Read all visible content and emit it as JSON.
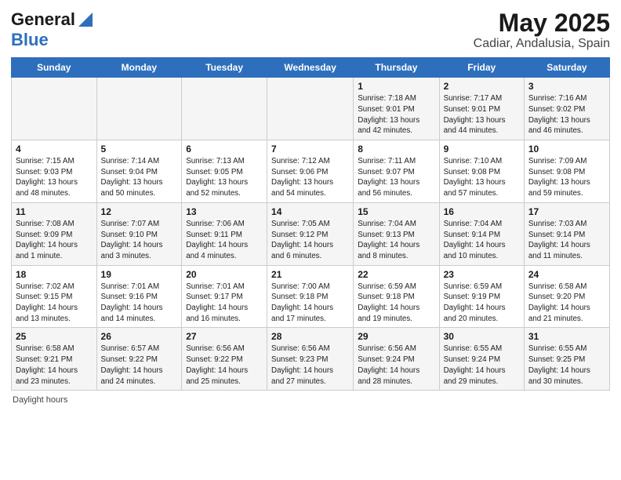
{
  "header": {
    "logo_line1": "General",
    "logo_line2": "Blue",
    "title": "May 2025",
    "subtitle": "Cadiar, Andalusia, Spain"
  },
  "days_of_week": [
    "Sunday",
    "Monday",
    "Tuesday",
    "Wednesday",
    "Thursday",
    "Friday",
    "Saturday"
  ],
  "footer_text": "Daylight hours",
  "weeks": [
    [
      {
        "day": "",
        "info": ""
      },
      {
        "day": "",
        "info": ""
      },
      {
        "day": "",
        "info": ""
      },
      {
        "day": "",
        "info": ""
      },
      {
        "day": "1",
        "info": "Sunrise: 7:18 AM\nSunset: 9:01 PM\nDaylight: 13 hours\nand 42 minutes."
      },
      {
        "day": "2",
        "info": "Sunrise: 7:17 AM\nSunset: 9:01 PM\nDaylight: 13 hours\nand 44 minutes."
      },
      {
        "day": "3",
        "info": "Sunrise: 7:16 AM\nSunset: 9:02 PM\nDaylight: 13 hours\nand 46 minutes."
      }
    ],
    [
      {
        "day": "4",
        "info": "Sunrise: 7:15 AM\nSunset: 9:03 PM\nDaylight: 13 hours\nand 48 minutes."
      },
      {
        "day": "5",
        "info": "Sunrise: 7:14 AM\nSunset: 9:04 PM\nDaylight: 13 hours\nand 50 minutes."
      },
      {
        "day": "6",
        "info": "Sunrise: 7:13 AM\nSunset: 9:05 PM\nDaylight: 13 hours\nand 52 minutes."
      },
      {
        "day": "7",
        "info": "Sunrise: 7:12 AM\nSunset: 9:06 PM\nDaylight: 13 hours\nand 54 minutes."
      },
      {
        "day": "8",
        "info": "Sunrise: 7:11 AM\nSunset: 9:07 PM\nDaylight: 13 hours\nand 56 minutes."
      },
      {
        "day": "9",
        "info": "Sunrise: 7:10 AM\nSunset: 9:08 PM\nDaylight: 13 hours\nand 57 minutes."
      },
      {
        "day": "10",
        "info": "Sunrise: 7:09 AM\nSunset: 9:08 PM\nDaylight: 13 hours\nand 59 minutes."
      }
    ],
    [
      {
        "day": "11",
        "info": "Sunrise: 7:08 AM\nSunset: 9:09 PM\nDaylight: 14 hours\nand 1 minute."
      },
      {
        "day": "12",
        "info": "Sunrise: 7:07 AM\nSunset: 9:10 PM\nDaylight: 14 hours\nand 3 minutes."
      },
      {
        "day": "13",
        "info": "Sunrise: 7:06 AM\nSunset: 9:11 PM\nDaylight: 14 hours\nand 4 minutes."
      },
      {
        "day": "14",
        "info": "Sunrise: 7:05 AM\nSunset: 9:12 PM\nDaylight: 14 hours\nand 6 minutes."
      },
      {
        "day": "15",
        "info": "Sunrise: 7:04 AM\nSunset: 9:13 PM\nDaylight: 14 hours\nand 8 minutes."
      },
      {
        "day": "16",
        "info": "Sunrise: 7:04 AM\nSunset: 9:14 PM\nDaylight: 14 hours\nand 10 minutes."
      },
      {
        "day": "17",
        "info": "Sunrise: 7:03 AM\nSunset: 9:14 PM\nDaylight: 14 hours\nand 11 minutes."
      }
    ],
    [
      {
        "day": "18",
        "info": "Sunrise: 7:02 AM\nSunset: 9:15 PM\nDaylight: 14 hours\nand 13 minutes."
      },
      {
        "day": "19",
        "info": "Sunrise: 7:01 AM\nSunset: 9:16 PM\nDaylight: 14 hours\nand 14 minutes."
      },
      {
        "day": "20",
        "info": "Sunrise: 7:01 AM\nSunset: 9:17 PM\nDaylight: 14 hours\nand 16 minutes."
      },
      {
        "day": "21",
        "info": "Sunrise: 7:00 AM\nSunset: 9:18 PM\nDaylight: 14 hours\nand 17 minutes."
      },
      {
        "day": "22",
        "info": "Sunrise: 6:59 AM\nSunset: 9:18 PM\nDaylight: 14 hours\nand 19 minutes."
      },
      {
        "day": "23",
        "info": "Sunrise: 6:59 AM\nSunset: 9:19 PM\nDaylight: 14 hours\nand 20 minutes."
      },
      {
        "day": "24",
        "info": "Sunrise: 6:58 AM\nSunset: 9:20 PM\nDaylight: 14 hours\nand 21 minutes."
      }
    ],
    [
      {
        "day": "25",
        "info": "Sunrise: 6:58 AM\nSunset: 9:21 PM\nDaylight: 14 hours\nand 23 minutes."
      },
      {
        "day": "26",
        "info": "Sunrise: 6:57 AM\nSunset: 9:22 PM\nDaylight: 14 hours\nand 24 minutes."
      },
      {
        "day": "27",
        "info": "Sunrise: 6:56 AM\nSunset: 9:22 PM\nDaylight: 14 hours\nand 25 minutes."
      },
      {
        "day": "28",
        "info": "Sunrise: 6:56 AM\nSunset: 9:23 PM\nDaylight: 14 hours\nand 27 minutes."
      },
      {
        "day": "29",
        "info": "Sunrise: 6:56 AM\nSunset: 9:24 PM\nDaylight: 14 hours\nand 28 minutes."
      },
      {
        "day": "30",
        "info": "Sunrise: 6:55 AM\nSunset: 9:24 PM\nDaylight: 14 hours\nand 29 minutes."
      },
      {
        "day": "31",
        "info": "Sunrise: 6:55 AM\nSunset: 9:25 PM\nDaylight: 14 hours\nand 30 minutes."
      }
    ]
  ]
}
